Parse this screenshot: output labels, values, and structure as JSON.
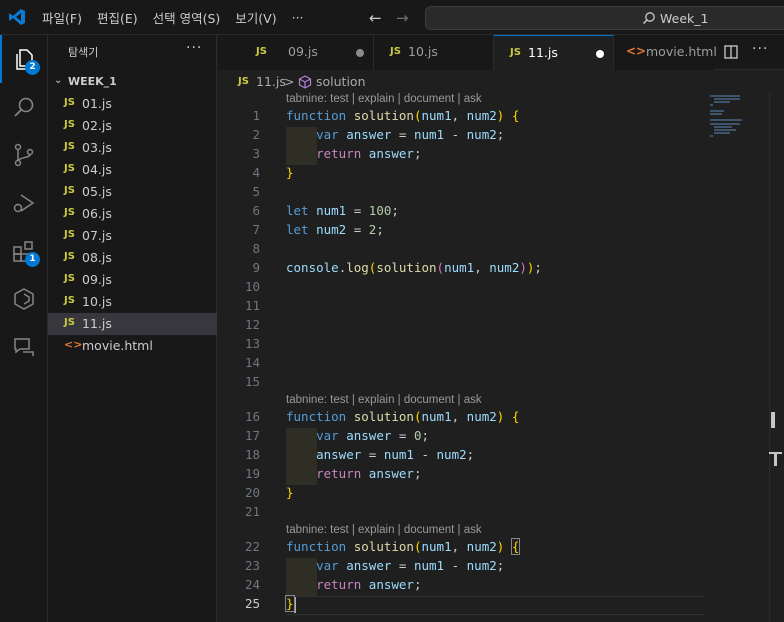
{
  "menu": [
    "파일(F)",
    "편집(E)",
    "선택 영역(S)",
    "보기(V)",
    "···"
  ],
  "search": {
    "text": "Week_1"
  },
  "activity": {
    "explorer_badge": "2",
    "extensions_badge": "1"
  },
  "sidebar": {
    "title": "탐색기",
    "more": "···",
    "folder": "WEEK_1",
    "files": [
      {
        "icon": "JS",
        "name": "01.js"
      },
      {
        "icon": "JS",
        "name": "02.js"
      },
      {
        "icon": "JS",
        "name": "03.js"
      },
      {
        "icon": "JS",
        "name": "04.js"
      },
      {
        "icon": "JS",
        "name": "05.js"
      },
      {
        "icon": "JS",
        "name": "06.js"
      },
      {
        "icon": "JS",
        "name": "07.js"
      },
      {
        "icon": "JS",
        "name": "08.js"
      },
      {
        "icon": "JS",
        "name": "09.js"
      },
      {
        "icon": "JS",
        "name": "10.js"
      },
      {
        "icon": "JS",
        "name": "11.js"
      },
      {
        "icon": "<>",
        "name": "movie.html"
      }
    ]
  },
  "tabs": [
    {
      "icon": "JS",
      "name": "09.js"
    },
    {
      "icon": "JS",
      "name": "10.js"
    },
    {
      "icon": "JS",
      "name": "11.js"
    },
    {
      "icon": "<>",
      "name": "movie.html"
    }
  ],
  "tabs_more": "···",
  "breadcrumb": {
    "icon": "JS",
    "file": "11.js",
    "sep": ">",
    "symbol": "solution"
  },
  "editor": {
    "lens": "tabnine: test | explain | document | ask",
    "line_numbers": [
      "1",
      "2",
      "3",
      "4",
      "5",
      "6",
      "7",
      "8",
      "9",
      "10",
      "11",
      "12",
      "13",
      "14",
      "15",
      "16",
      "17",
      "18",
      "19",
      "20",
      "21",
      "22",
      "23",
      "24",
      "25"
    ]
  }
}
